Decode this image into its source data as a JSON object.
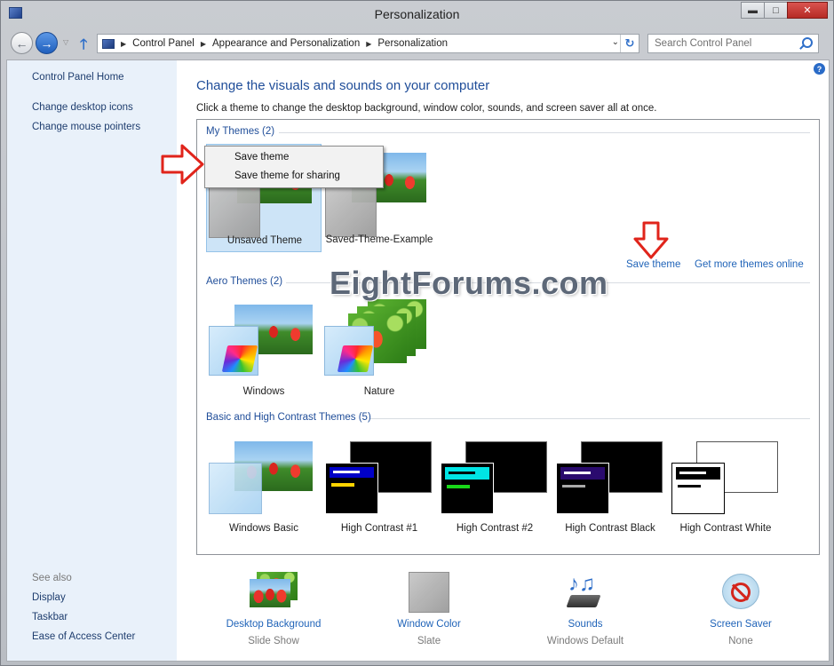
{
  "window": {
    "title": "Personalization"
  },
  "address": {
    "crumbs": [
      "Control Panel",
      "Appearance and Personalization",
      "Personalization"
    ],
    "search_placeholder": "Search Control Panel"
  },
  "sidebar": {
    "links": [
      "Control Panel Home",
      "Change desktop icons",
      "Change mouse pointers"
    ],
    "see_also_label": "See also",
    "see_also": [
      "Display",
      "Taskbar",
      "Ease of Access Center"
    ]
  },
  "main": {
    "title": "Change the visuals and sounds on your computer",
    "subtitle": "Click a theme to change the desktop background, window color, sounds, and screen saver all at once."
  },
  "groups": {
    "my_themes": {
      "label": "My Themes (2)",
      "themes": [
        "Unsaved Theme",
        "Saved-Theme-Example"
      ]
    },
    "aero_themes": {
      "label": "Aero Themes (2)",
      "themes": [
        "Windows",
        "Nature"
      ]
    },
    "basic_themes": {
      "label": "Basic and High Contrast Themes (5)",
      "themes": [
        "Windows Basic",
        "High Contrast #1",
        "High Contrast #2",
        "High Contrast Black",
        "High Contrast White"
      ]
    }
  },
  "links": {
    "save_theme": "Save theme",
    "get_more": "Get more themes online"
  },
  "context_menu": {
    "items": [
      "Save theme",
      "Save theme for sharing"
    ]
  },
  "watermark": "EightForums.com",
  "bottom": {
    "items": [
      {
        "label": "Desktop Background",
        "sub": "Slide Show"
      },
      {
        "label": "Window Color",
        "sub": "Slate"
      },
      {
        "label": "Sounds",
        "sub": "Windows Default"
      },
      {
        "label": "Screen Saver",
        "sub": "None"
      }
    ]
  },
  "colors": {
    "accent": "#1f4d99",
    "link": "#1f63b8",
    "arrow": "#e0241b",
    "sidebar": "#e9f1fa"
  }
}
